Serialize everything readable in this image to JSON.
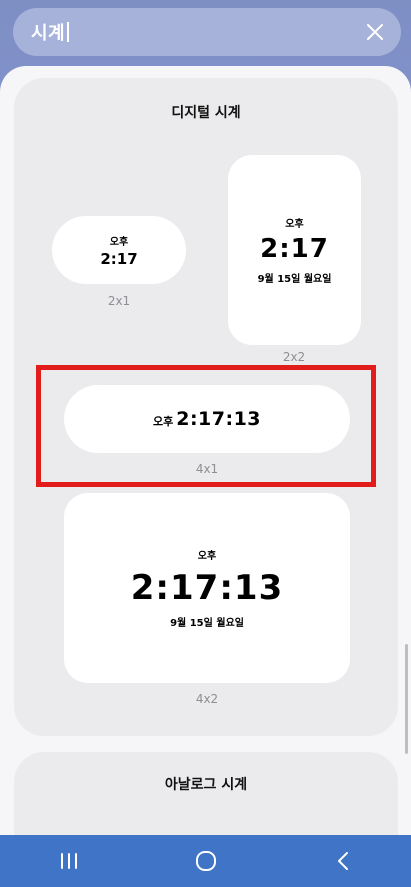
{
  "search": {
    "query": "시계"
  },
  "digital": {
    "title": "디지털 시계",
    "widget_2x1": {
      "ampm": "오후",
      "time": "2:17",
      "size": "2x1"
    },
    "widget_2x2": {
      "ampm": "오후",
      "time": "2:17",
      "date": "9월 15일 월요일",
      "size": "2x2"
    },
    "widget_4x1": {
      "ampm": "오후",
      "time": "2:17:13",
      "size": "4x1"
    },
    "widget_4x2": {
      "ampm": "오후",
      "time": "2:17:13",
      "date": "9월 15일 월요일",
      "size": "4x2"
    }
  },
  "analog": {
    "title": "아날로그 시계"
  },
  "nav": {
    "recents": "recents-icon",
    "home": "home-icon",
    "back": "back-icon"
  },
  "colors": {
    "highlight": "#E21B1B",
    "navbar": "#3F74C6",
    "header": "#7E8FC4"
  }
}
